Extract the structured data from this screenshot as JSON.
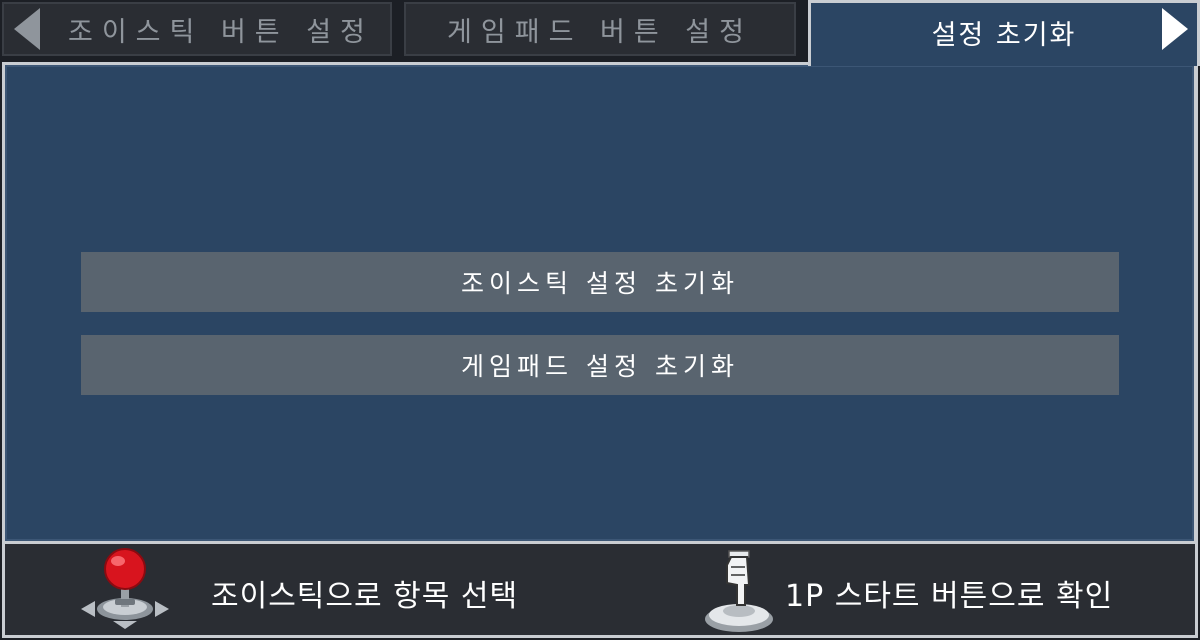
{
  "tabs": [
    {
      "label": "조이스틱 버튼 설정",
      "active": false
    },
    {
      "label": "게임패드 버튼 설정",
      "active": false
    },
    {
      "label": "설정 초기화",
      "active": true
    }
  ],
  "nav": {
    "prev_icon": "triangle-left-icon",
    "next_icon": "triangle-right-icon"
  },
  "menu": {
    "items": [
      {
        "label": "조이스틱 설정 초기화"
      },
      {
        "label": "게임패드 설정 초기화"
      }
    ]
  },
  "help": {
    "select_icon": "joystick-icon",
    "select_text": "조이스틱으로 항목 선택",
    "confirm_icon": "start-button-press-icon",
    "confirm_text": "1P 스타트 버튼으로 확인"
  },
  "colors": {
    "panel_bg": "#2b4563",
    "button_bg": "#59646f",
    "tab_inactive_bg": "#2a2d33",
    "frame": "#c9cdd2",
    "joystick_ball": "#d8141e"
  }
}
